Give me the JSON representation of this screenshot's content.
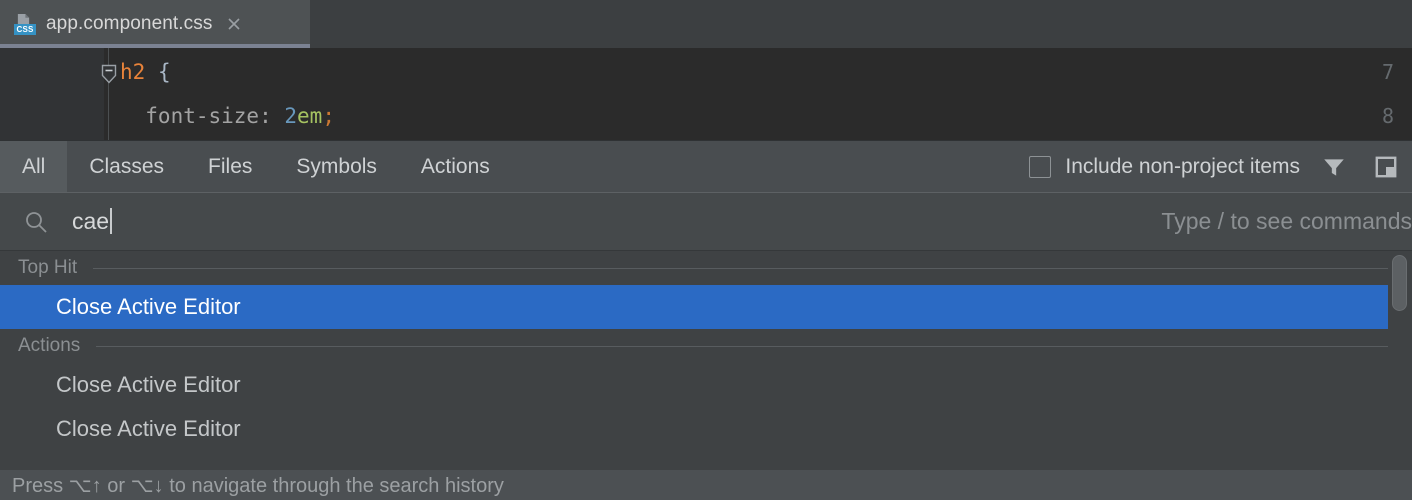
{
  "editor": {
    "tab": {
      "filename": "app.component.css",
      "file_type_badge": "CSS",
      "close_icon": "close-icon"
    },
    "lines": [
      {
        "number": "7",
        "text": "h2 {"
      },
      {
        "number": "8",
        "text": "    font-size: 2em;"
      }
    ],
    "code": {
      "line7_selector": "h2",
      "line7_brace": " {",
      "line8_property": "  font-size: ",
      "line8_number": "2",
      "line8_unit": "em",
      "line8_semicolon": ";"
    }
  },
  "search_everywhere": {
    "tabs": [
      {
        "label": "All",
        "active": true
      },
      {
        "label": "Classes",
        "active": false
      },
      {
        "label": "Files",
        "active": false
      },
      {
        "label": "Symbols",
        "active": false
      },
      {
        "label": "Actions",
        "active": false
      }
    ],
    "include_non_project": {
      "label": "Include non-project items",
      "checked": false
    },
    "toolbar_icons": [
      {
        "name": "filter-icon"
      },
      {
        "name": "preview-panel-icon"
      }
    ],
    "search": {
      "icon": "search-icon",
      "value": "cae",
      "placeholder": "Type / to see commands",
      "hint_right": "Type / to see commands"
    },
    "groups": [
      {
        "label": "Top Hit",
        "items": [
          {
            "label": "Close Active Editor",
            "selected": true
          }
        ]
      },
      {
        "label": "Actions",
        "items": [
          {
            "label": "Close Active Editor",
            "selected": false
          },
          {
            "label": "Close Active Editor",
            "selected": false
          }
        ]
      }
    ],
    "hint_bar": {
      "text": "Press ⌥↑ or ⌥↓ to navigate through the search history"
    },
    "colors": {
      "selection": "#2b6ac4",
      "popup_background": "#3f4244",
      "tabbar_background": "#494d50",
      "search_background": "#45494b"
    }
  }
}
